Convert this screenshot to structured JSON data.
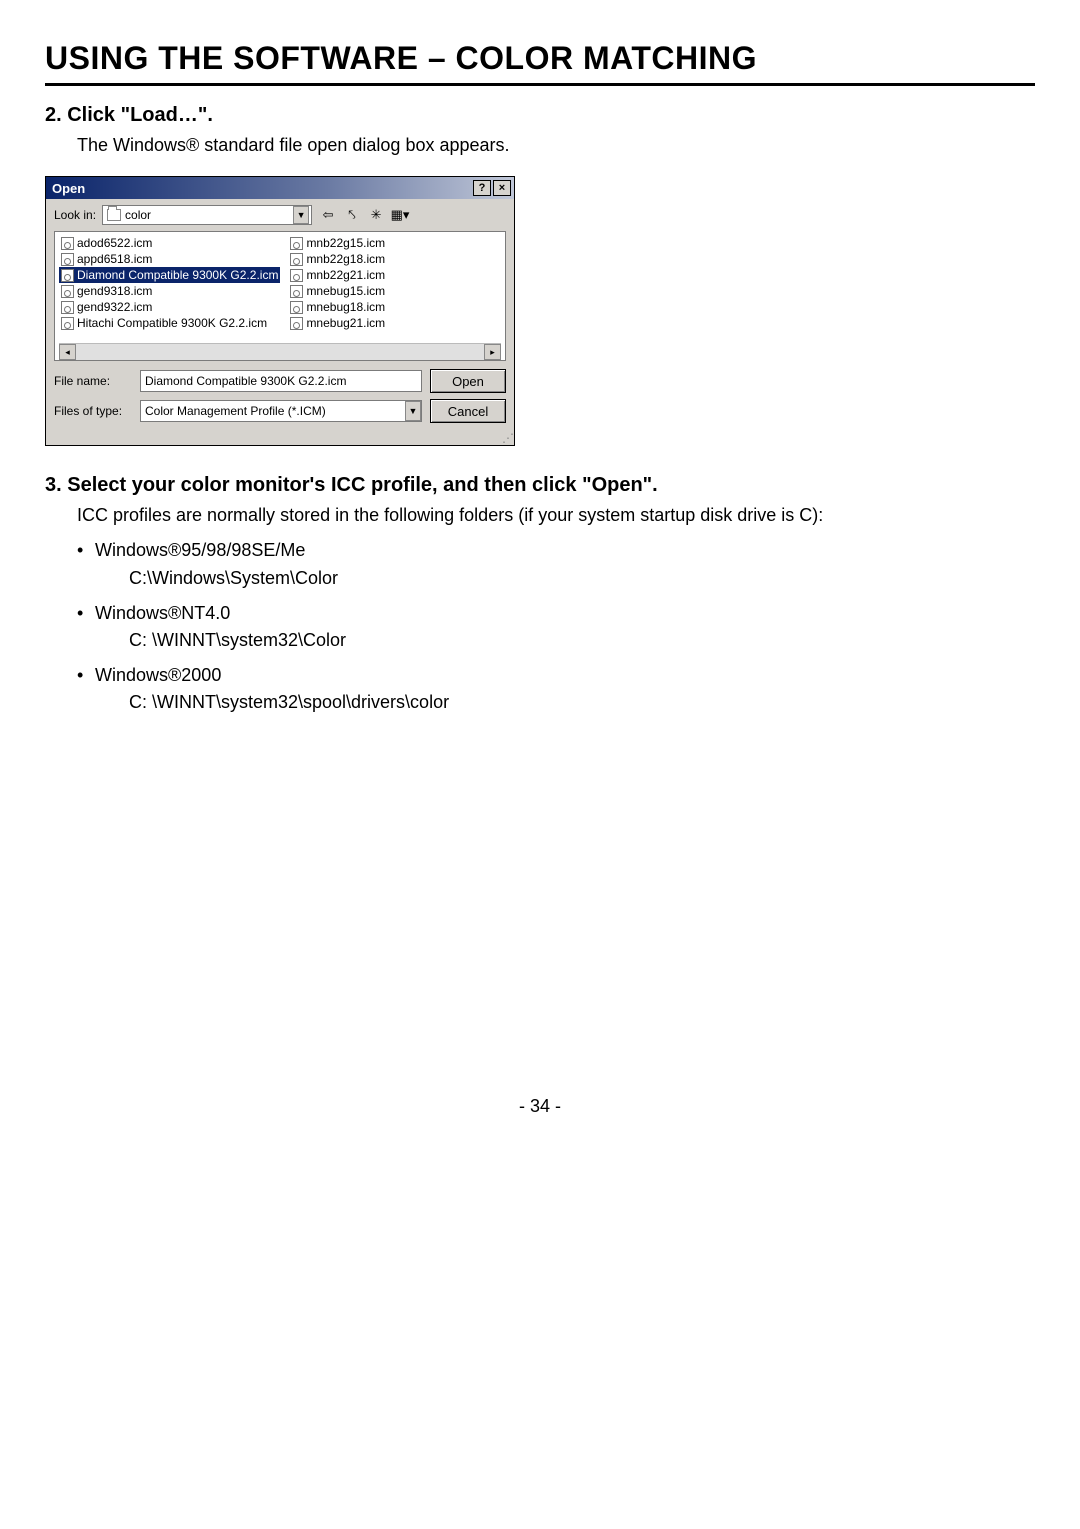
{
  "title": "USING THE SOFTWARE – COLOR MATCHING",
  "step2": {
    "heading": "2.  Click \"Load…\".",
    "body": "The Windows® standard file open dialog box appears."
  },
  "dialog": {
    "title": "Open",
    "help_btn": "?",
    "close_btn": "×",
    "lookin_label": "Look in:",
    "lookin_value": "color",
    "nav": {
      "back": "⇦",
      "up": "⤣",
      "new": "✳",
      "view": "▦▾"
    },
    "files_col1": [
      "adod6522.icm",
      "appd6518.icm",
      "Diamond Compatible 9300K G2.2.icm",
      "gend9318.icm",
      "gend9322.icm",
      "Hitachi Compatible 9300K G2.2.icm"
    ],
    "files_col2": [
      "mnb22g15.icm",
      "mnb22g18.icm",
      "mnb22g21.icm",
      "mnebug15.icm",
      "mnebug18.icm",
      "mnebug21.icm"
    ],
    "selected_index": 2,
    "file_name_label": "File name:",
    "file_name_value": "Diamond Compatible 9300K G2.2.icm",
    "file_type_label": "Files of type:",
    "file_type_value": "Color Management Profile (*.ICM)",
    "open_btn": "Open",
    "cancel_btn": "Cancel",
    "scroll_left": "◂",
    "scroll_right": "▸",
    "dropdown_arrow": "▼"
  },
  "step3": {
    "heading": "3.  Select your color monitor's ICC profile, and then click \"Open\".",
    "body": "ICC profiles are normally stored in the following folders (if your system startup disk drive is C):",
    "bullets": [
      {
        "label": "Windows®95/98/98SE/Me",
        "path": "C:\\Windows\\System\\Color"
      },
      {
        "label": "Windows®NT4.0",
        "path": "C: \\WINNT\\system32\\Color"
      },
      {
        "label": "Windows®2000",
        "path": "C: \\WINNT\\system32\\spool\\drivers\\color"
      }
    ]
  },
  "page_number": "- 34 -"
}
